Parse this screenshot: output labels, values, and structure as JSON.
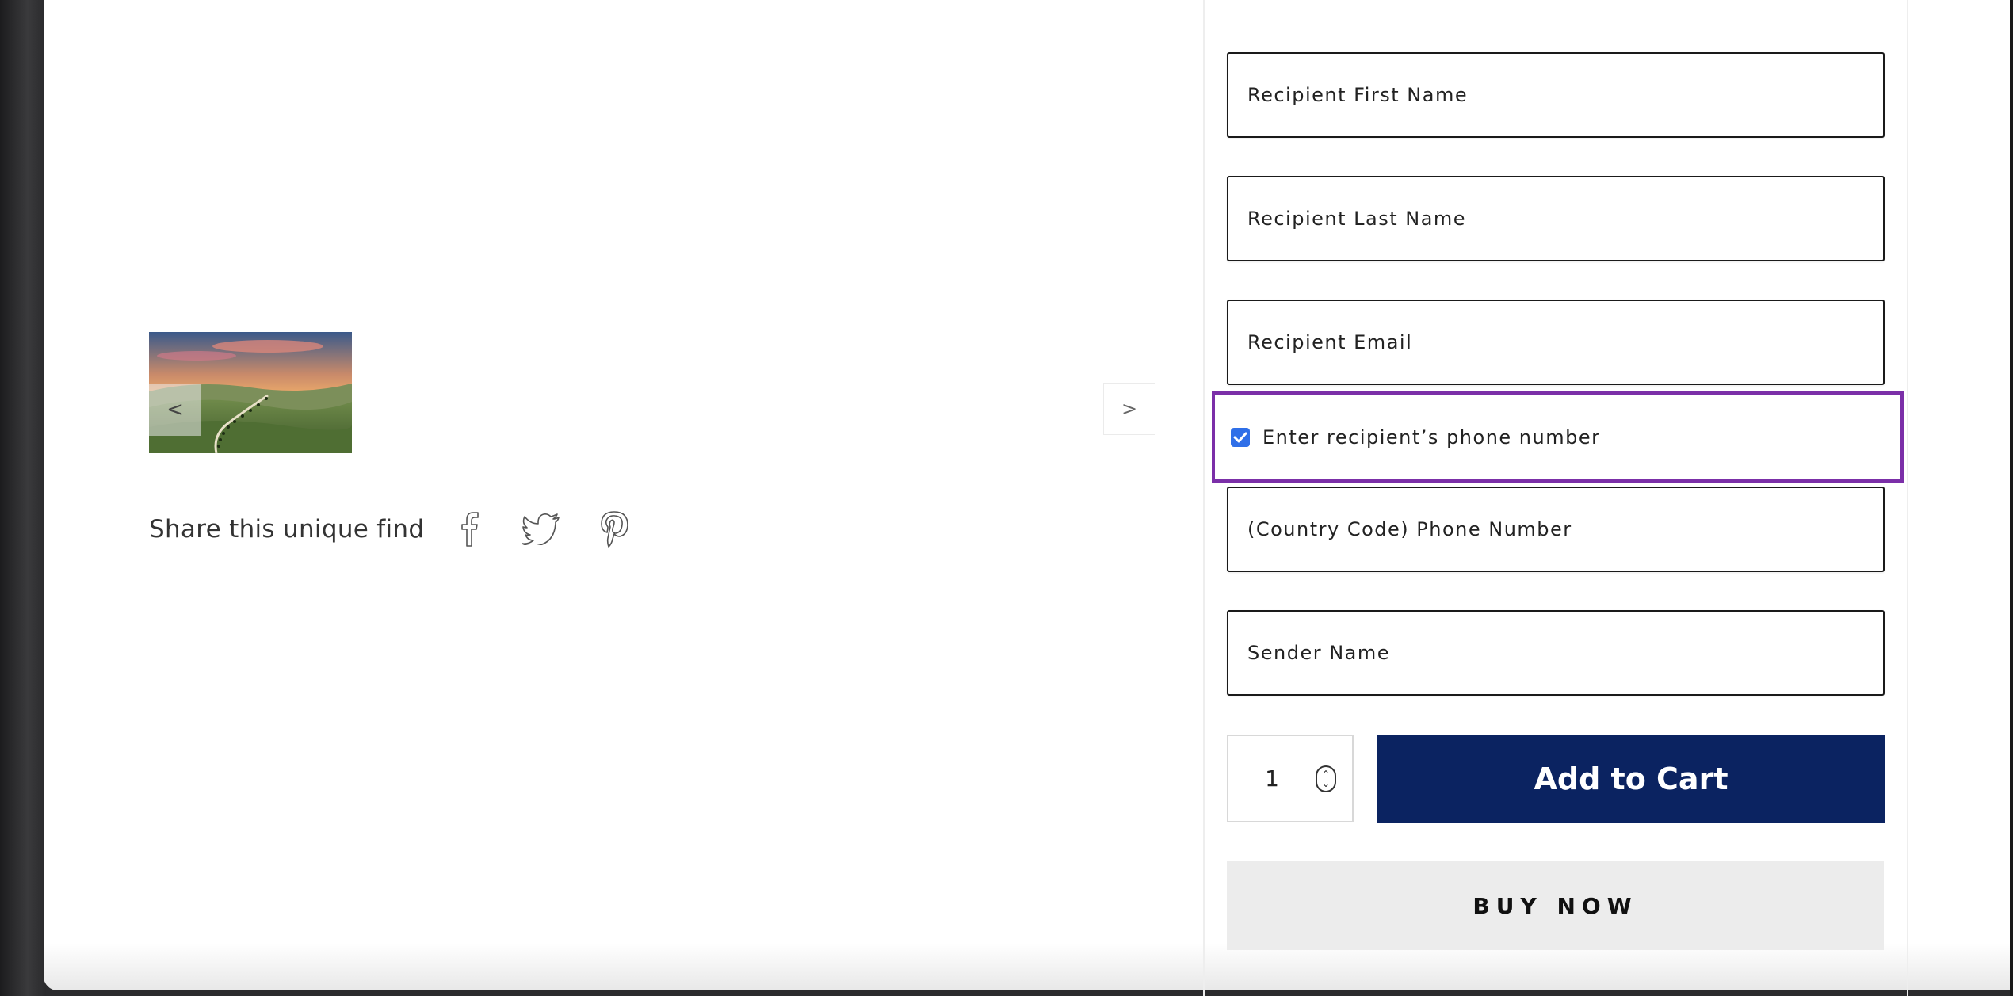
{
  "gallery": {
    "prev_label": "<",
    "next_label": ">"
  },
  "share": {
    "label": "Share this unique find",
    "icons": [
      "facebook-icon",
      "twitter-icon",
      "pinterest-icon"
    ]
  },
  "form": {
    "recipient_first_name_placeholder": "Recipient First Name",
    "recipient_last_name_placeholder": "Recipient Last Name",
    "recipient_email_placeholder": "Recipient Email",
    "phone_toggle_label": "Enter recipient’s phone number",
    "phone_toggle_checked": true,
    "phone_placeholder": "(Country Code) Phone Number",
    "sender_name_placeholder": "Sender Name"
  },
  "cart": {
    "quantity": "1",
    "add_to_cart_label": "Add to Cart",
    "buy_now_label": "BUY NOW"
  },
  "colors": {
    "add_to_cart_bg": "#0b2361",
    "buy_now_bg": "#ececec",
    "highlight_border": "#7b2fa8",
    "checkbox": "#2f6fe8"
  }
}
